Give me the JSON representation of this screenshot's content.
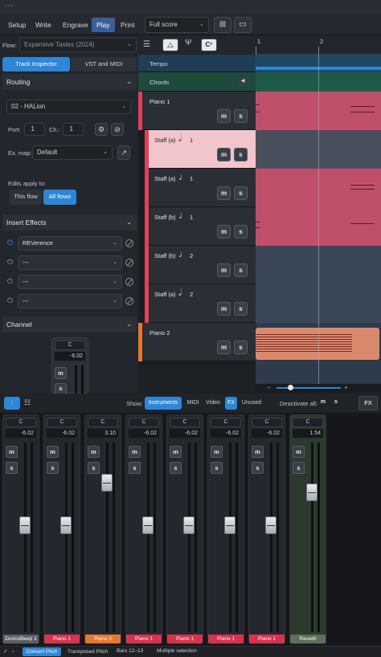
{
  "toolbar": {
    "tabs": [
      "Setup",
      "Write",
      "Engrave",
      "Play",
      "Print"
    ],
    "active_tab": "Play",
    "layout_select": "Full score"
  },
  "flow": {
    "label": "Flow:",
    "value": "Expansive Tastes (2024)"
  },
  "inspector": {
    "tab_track_inspector": "Track Inspector",
    "tab_vst_midi": "VST and MIDI",
    "routing": {
      "title": "Routing",
      "device": "02 - HALion",
      "port_label": "Port:",
      "port_value": "1",
      "ch_label": "Ch.:",
      "ch_value": "1",
      "exmap_label": "Ex. map:",
      "exmap_value": "Default",
      "edits_apply_label": "Edits apply to:",
      "this_flow": "This flow",
      "all_flows": "All flows"
    },
    "insert_effects": {
      "title": "Insert Effects",
      "slots": [
        "REVerence",
        "---",
        "---",
        "---"
      ]
    },
    "channel": {
      "title": "Channel",
      "pan": "C",
      "volume": "-6.02",
      "mute": "m",
      "solo": "s"
    }
  },
  "tracklist": {
    "tempo": "Tempo",
    "chords": "Chords",
    "tracks": [
      {
        "name": "Piano 1",
        "type": "instrument",
        "color": "#e0405a"
      },
      {
        "name": "Staff (a)",
        "voice": "1",
        "note": "half",
        "color": "#e0405a",
        "selected": true
      },
      {
        "name": "Staff (a)",
        "voice": "1",
        "note": "quarter",
        "color": "#e0405a"
      },
      {
        "name": "Staff (b)",
        "voice": "1",
        "note": "quarter",
        "color": "#e0405a"
      },
      {
        "name": "Staff (b)",
        "voice": "2",
        "note": "quarter",
        "color": "#e0405a"
      },
      {
        "name": "Staff (a)",
        "voice": "2",
        "note": "half",
        "color": "#e0405a"
      },
      {
        "name": "Piano 2",
        "type": "instrument",
        "color": "#e8772e"
      }
    ],
    "mute_label": "m",
    "solo_label": "s"
  },
  "timeline": {
    "bar_numbers": [
      "1",
      "2"
    ]
  },
  "mixer": {
    "show_label": "Show:",
    "filters": [
      {
        "label": "Instruments",
        "active": true
      },
      {
        "label": "MIDI",
        "active": false
      },
      {
        "label": "Video",
        "active": false
      },
      {
        "label": "FX",
        "active": true
      },
      {
        "label": "Unused",
        "active": false
      }
    ],
    "deactivate_all": "Deactivate all:",
    "fx_button": "FX",
    "strips": [
      {
        "name": "DoricoBeep 1",
        "pan": "C",
        "volume": "-6.02",
        "fader_level": 0.57,
        "color": "#5a5e66"
      },
      {
        "name": "Piano 1",
        "pan": "C",
        "volume": "-6.02",
        "fader_level": 0.57,
        "color": "#d8324c"
      },
      {
        "name": "Piano 2",
        "pan": "C",
        "volume": "3.10",
        "fader_level": 0.82,
        "color": "#e8772e"
      },
      {
        "name": "Piano 1",
        "pan": "C",
        "volume": "-6.02",
        "fader_level": 0.57,
        "color": "#d8324c"
      },
      {
        "name": "Piano 1",
        "pan": "C",
        "volume": "-6.02",
        "fader_level": 0.57,
        "color": "#d8324c"
      },
      {
        "name": "Piano 1",
        "pan": "C",
        "volume": "-6.02",
        "fader_level": 0.57,
        "color": "#d8324c"
      },
      {
        "name": "Piano 1",
        "pan": "C",
        "volume": "-6.02",
        "fader_level": 0.57,
        "color": "#d8324c"
      },
      {
        "name": "Reverb",
        "pan": "C",
        "volume": "1.54",
        "fader_level": 0.76,
        "color": "#5c6f5a"
      }
    ],
    "mute": "m",
    "solo": "s"
  },
  "statusbar": {
    "concert_pitch": "Concert Pitch",
    "transposed_pitch": "Transposed Pitch",
    "bars": "Bars 12–13",
    "selection": "Multiple selection"
  }
}
